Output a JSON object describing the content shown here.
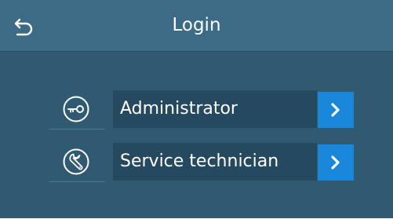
{
  "header": {
    "title": "Login",
    "back_icon": "back-return-icon"
  },
  "login_options": [
    {
      "label": "Administrator",
      "icon": "key-icon",
      "action_icon": "chevron-right-icon"
    },
    {
      "label": "Service technician",
      "icon": "wrench-icon",
      "action_icon": "chevron-right-icon"
    }
  ],
  "colors": {
    "header_bg": "#3d6a85",
    "screen_bg": "#2f5a72",
    "label_bg": "#25495e",
    "accent": "#1a87db"
  }
}
